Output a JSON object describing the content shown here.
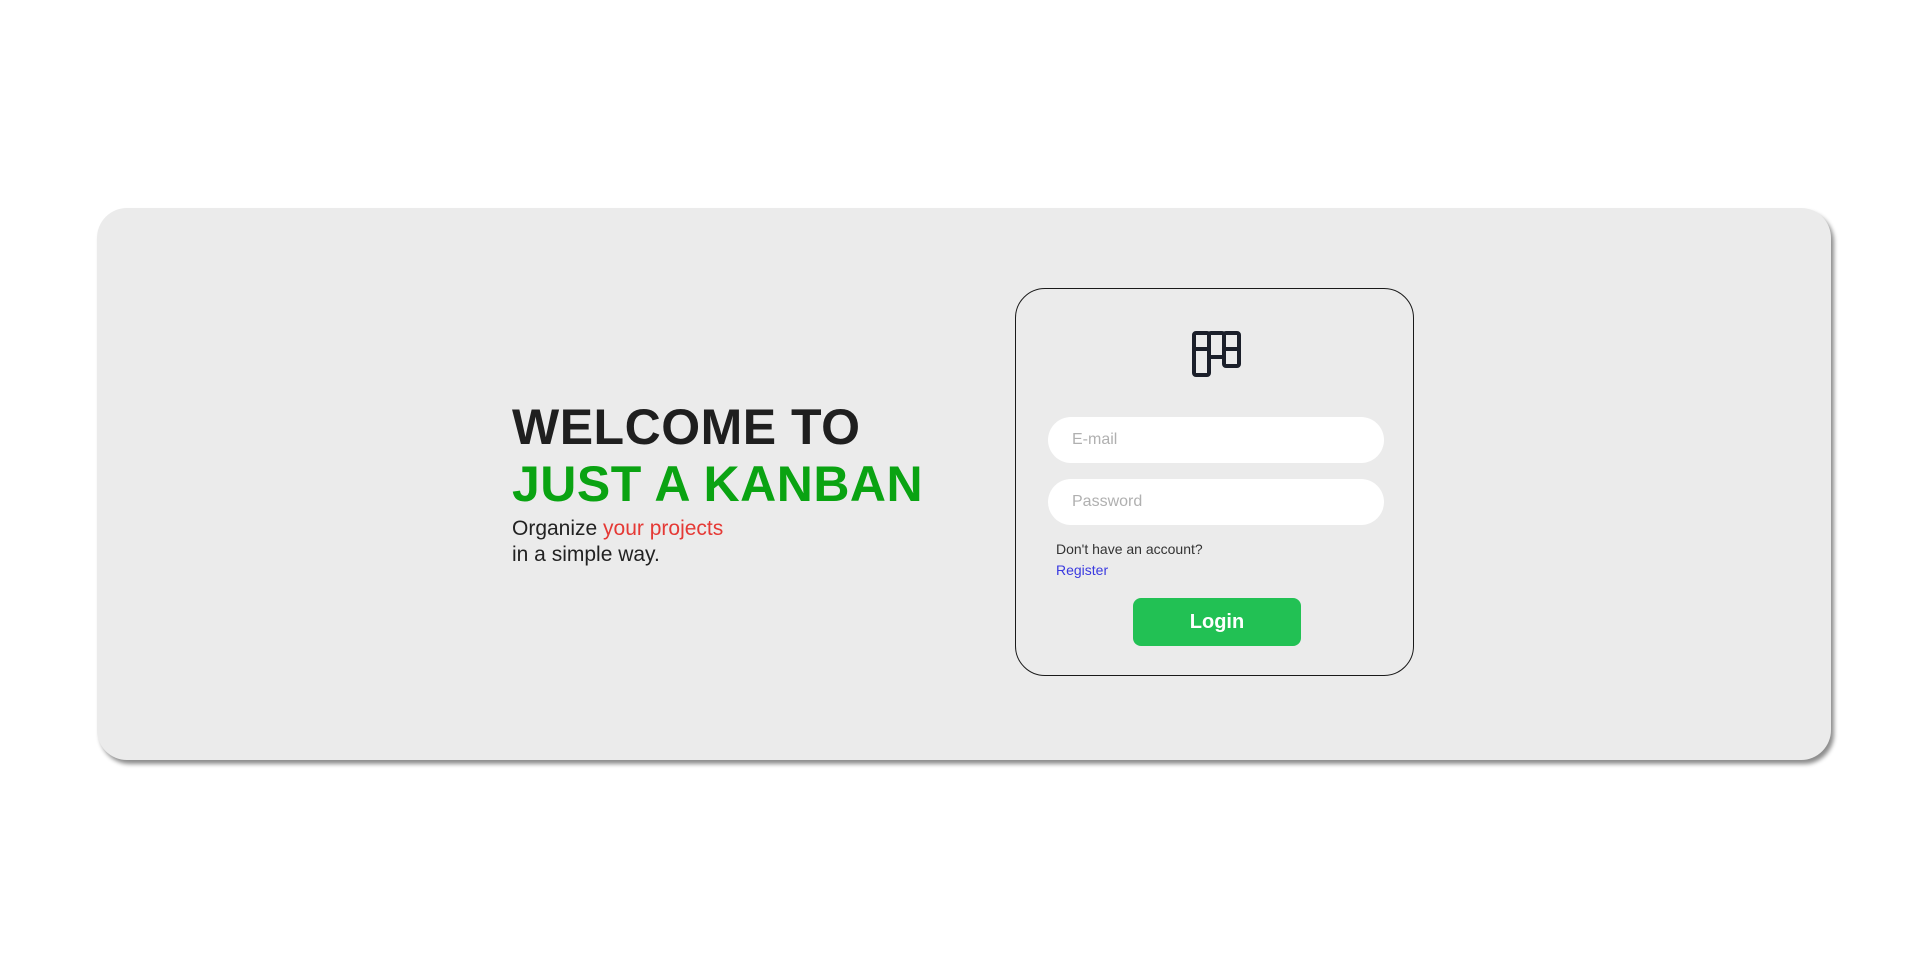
{
  "hero": {
    "line1": "WELCOME TO",
    "line2": "JUST A KANBAN",
    "tagline_prefix": "Organize ",
    "tagline_accent": "your projects",
    "tagline_line2": "in a simple way."
  },
  "login_form": {
    "logo_icon": "kanban-board-icon",
    "email_placeholder": "E-mail",
    "email_value": "",
    "password_placeholder": "Password",
    "password_value": "",
    "no_account_text": "Don't have an account?",
    "register_label": "Register",
    "login_label": "Login"
  },
  "colors": {
    "accent_green": "#0aa312",
    "accent_red": "#e53935",
    "button_green": "#22c154",
    "link_blue": "#3a3ae0",
    "panel_bg": "#ebebeb"
  }
}
